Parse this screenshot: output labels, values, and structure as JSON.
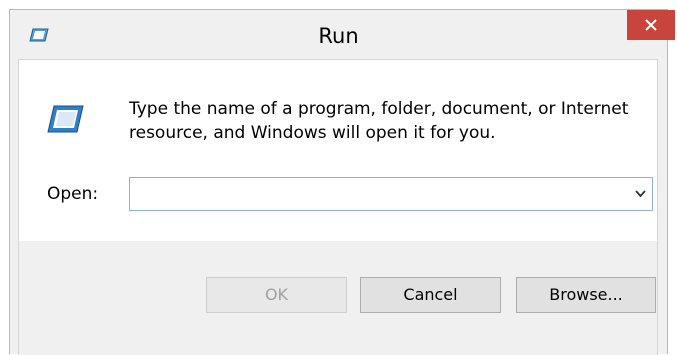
{
  "window": {
    "title": "Run",
    "close_symbol": "✕"
  },
  "icons": {
    "title_icon": "run-app-icon",
    "main_icon": "run-app-icon",
    "close_icon": "close-icon",
    "dropdown_icon": "chevron-down-icon"
  },
  "prompt": {
    "text": "Type the name of a program, folder, document, or Internet\nresource, and Windows will open it for you."
  },
  "open_field": {
    "label": "Open:",
    "value": "",
    "placeholder": ""
  },
  "buttons": {
    "ok_label": "OK",
    "cancel_label": "Cancel",
    "browse_label": "Browse..."
  },
  "colors": {
    "close_button": "#c7453c",
    "icon_blue": "#1f6fb5",
    "input_border": "#8fb0d7"
  }
}
